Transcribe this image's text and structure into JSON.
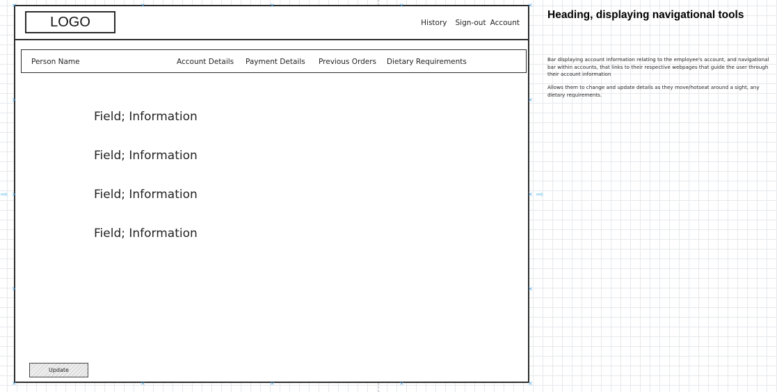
{
  "header": {
    "logo_text": "LOGO",
    "links": [
      "History",
      "Sign-out",
      "Account"
    ]
  },
  "navbar": {
    "person_name": "Person Name",
    "items": [
      "Account Details",
      "Payment Details",
      "Previous Orders",
      "Dietary Requirements"
    ]
  },
  "main": {
    "fields": [
      "Field; Information",
      "Field; Information",
      "Field; Information",
      "Field; Information"
    ]
  },
  "footer": {
    "update_label": "Update"
  },
  "annotation": {
    "heading": "Heading, displaying navigational tools",
    "note_1": "Bar displaying account information relating to the employee's account, and navigational bar within accounts, that links to their respective webpages that guide the user through their account information",
    "note_2": "Allows them to change and update details as they move/hotseat around a sight, any dietary requirements."
  },
  "colors": {
    "ink": "#2a2a2a",
    "grid": "#e6e8ec",
    "selection": "#4aa3e0"
  }
}
